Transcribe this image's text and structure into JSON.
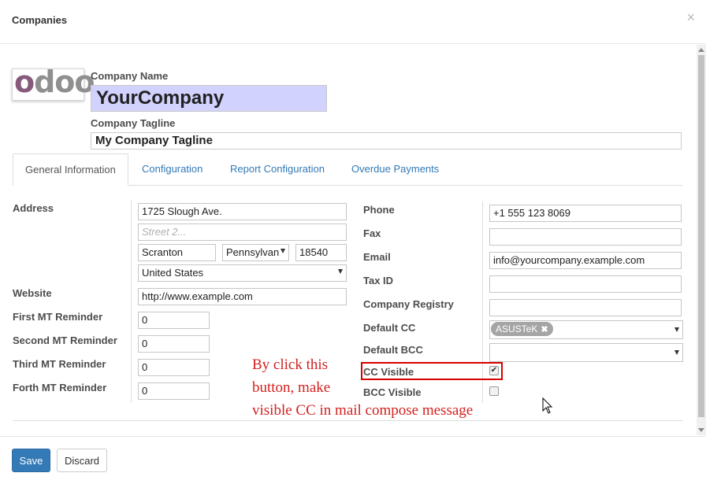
{
  "dialog": {
    "title": "Companies",
    "close_glyph": "×"
  },
  "logo": {
    "text_o": "o",
    "text_rest": "doo"
  },
  "company": {
    "name_label": "Company Name",
    "name_value": "YourCompany",
    "tagline_label": "Company Tagline",
    "tagline_value": "My Company Tagline"
  },
  "tabs": [
    {
      "label": "General Information",
      "active": true
    },
    {
      "label": "Configuration"
    },
    {
      "label": "Report Configuration"
    },
    {
      "label": "Overdue Payments"
    }
  ],
  "left": {
    "address_label": "Address",
    "street": "1725 Slough Ave.",
    "street2_placeholder": "Street 2...",
    "city": "Scranton",
    "state": "Pennsylvan",
    "zip": "18540",
    "country": "United States",
    "website_label": "Website",
    "website": "http://www.example.com",
    "reminders": [
      {
        "label": "First MT Reminder",
        "value": "0"
      },
      {
        "label": "Second MT Reminder",
        "value": "0"
      },
      {
        "label": "Third MT Reminder",
        "value": "0"
      },
      {
        "label": "Forth MT Reminder",
        "value": "0"
      }
    ]
  },
  "right": {
    "phone_label": "Phone",
    "phone": "+1 555 123 8069",
    "fax_label": "Fax",
    "fax": "",
    "email_label": "Email",
    "email": "info@yourcompany.example.com",
    "taxid_label": "Tax ID",
    "taxid": "",
    "registry_label": "Company Registry",
    "registry": "",
    "default_cc_label": "Default CC",
    "default_cc_tag": "ASUSTeK",
    "tag_remove_glyph": "✖",
    "default_bcc_label": "Default BCC",
    "cc_visible_label": "CC Visible",
    "cc_visible_checked": true,
    "check_glyph": "✔",
    "bcc_visible_label": "BCC Visible",
    "bcc_visible_checked": false
  },
  "annotation": {
    "line1": "By click this",
    "line2": "button, make",
    "line3": "visible CC in mail compose message"
  },
  "footer": {
    "save_label": "Save",
    "discard_label": "Discard"
  },
  "colors": {
    "primary": "#337ab7",
    "highlight": "#d60000",
    "annotation": "#d32020",
    "name_bg": "#d2d2ff"
  }
}
